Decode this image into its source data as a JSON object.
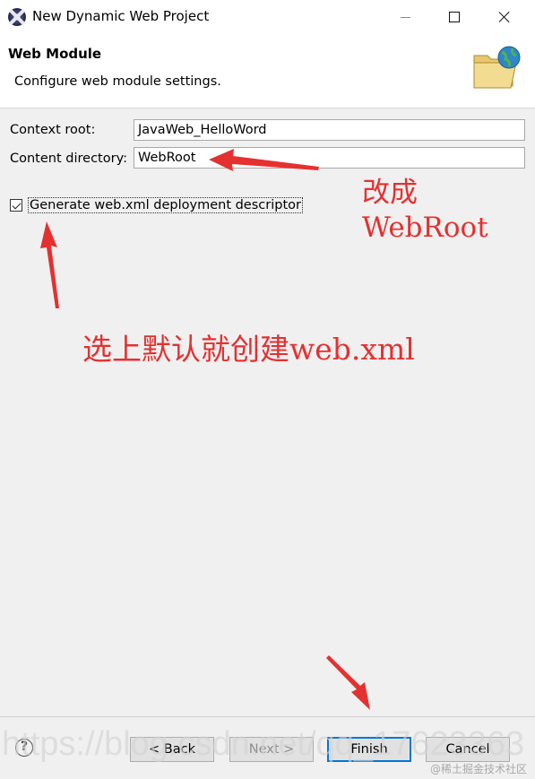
{
  "window": {
    "title": "New Dynamic Web Project",
    "icon": "eclipse-icon"
  },
  "banner": {
    "title": "Web Module",
    "description": "Configure web module settings.",
    "icon": "folder-globe-icon"
  },
  "form": {
    "context_root_label": "Context root:",
    "context_root_value": "JavaWeb_HelloWord",
    "content_directory_label": "Content directory:",
    "content_directory_value": "WebRoot",
    "generate_checkbox_label": "Generate web.xml deployment descriptor",
    "generate_checked": true
  },
  "annotations": {
    "change_to_line1": "改成",
    "change_to_line2": "WebRoot",
    "select_default": "选上默认就创建web.xml",
    "color": "#e53030"
  },
  "buttons": {
    "back": "< Back",
    "next": "Next >",
    "finish": "Finish",
    "cancel": "Cancel",
    "help_icon": "question-mark-icon"
  },
  "watermark": {
    "url": "https://blog.csdn.net/qq_17623363",
    "site": "@稀土掘金技术社区"
  },
  "colors": {
    "accent": "#0078d7",
    "window_bg": "#f0f0f0"
  }
}
